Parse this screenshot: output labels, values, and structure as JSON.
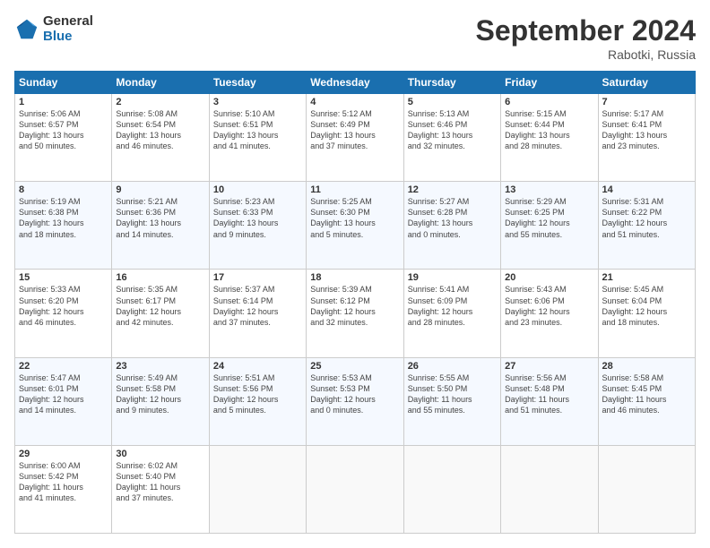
{
  "header": {
    "logo_general": "General",
    "logo_blue": "Blue",
    "month_title": "September 2024",
    "subtitle": "Rabotki, Russia"
  },
  "days_of_week": [
    "Sunday",
    "Monday",
    "Tuesday",
    "Wednesday",
    "Thursday",
    "Friday",
    "Saturday"
  ],
  "weeks": [
    [
      {
        "day": 1,
        "info": "Sunrise: 5:06 AM\nSunset: 6:57 PM\nDaylight: 13 hours\nand 50 minutes."
      },
      {
        "day": 2,
        "info": "Sunrise: 5:08 AM\nSunset: 6:54 PM\nDaylight: 13 hours\nand 46 minutes."
      },
      {
        "day": 3,
        "info": "Sunrise: 5:10 AM\nSunset: 6:51 PM\nDaylight: 13 hours\nand 41 minutes."
      },
      {
        "day": 4,
        "info": "Sunrise: 5:12 AM\nSunset: 6:49 PM\nDaylight: 13 hours\nand 37 minutes."
      },
      {
        "day": 5,
        "info": "Sunrise: 5:13 AM\nSunset: 6:46 PM\nDaylight: 13 hours\nand 32 minutes."
      },
      {
        "day": 6,
        "info": "Sunrise: 5:15 AM\nSunset: 6:44 PM\nDaylight: 13 hours\nand 28 minutes."
      },
      {
        "day": 7,
        "info": "Sunrise: 5:17 AM\nSunset: 6:41 PM\nDaylight: 13 hours\nand 23 minutes."
      }
    ],
    [
      {
        "day": 8,
        "info": "Sunrise: 5:19 AM\nSunset: 6:38 PM\nDaylight: 13 hours\nand 18 minutes."
      },
      {
        "day": 9,
        "info": "Sunrise: 5:21 AM\nSunset: 6:36 PM\nDaylight: 13 hours\nand 14 minutes."
      },
      {
        "day": 10,
        "info": "Sunrise: 5:23 AM\nSunset: 6:33 PM\nDaylight: 13 hours\nand 9 minutes."
      },
      {
        "day": 11,
        "info": "Sunrise: 5:25 AM\nSunset: 6:30 PM\nDaylight: 13 hours\nand 5 minutes."
      },
      {
        "day": 12,
        "info": "Sunrise: 5:27 AM\nSunset: 6:28 PM\nDaylight: 13 hours\nand 0 minutes."
      },
      {
        "day": 13,
        "info": "Sunrise: 5:29 AM\nSunset: 6:25 PM\nDaylight: 12 hours\nand 55 minutes."
      },
      {
        "day": 14,
        "info": "Sunrise: 5:31 AM\nSunset: 6:22 PM\nDaylight: 12 hours\nand 51 minutes."
      }
    ],
    [
      {
        "day": 15,
        "info": "Sunrise: 5:33 AM\nSunset: 6:20 PM\nDaylight: 12 hours\nand 46 minutes."
      },
      {
        "day": 16,
        "info": "Sunrise: 5:35 AM\nSunset: 6:17 PM\nDaylight: 12 hours\nand 42 minutes."
      },
      {
        "day": 17,
        "info": "Sunrise: 5:37 AM\nSunset: 6:14 PM\nDaylight: 12 hours\nand 37 minutes."
      },
      {
        "day": 18,
        "info": "Sunrise: 5:39 AM\nSunset: 6:12 PM\nDaylight: 12 hours\nand 32 minutes."
      },
      {
        "day": 19,
        "info": "Sunrise: 5:41 AM\nSunset: 6:09 PM\nDaylight: 12 hours\nand 28 minutes."
      },
      {
        "day": 20,
        "info": "Sunrise: 5:43 AM\nSunset: 6:06 PM\nDaylight: 12 hours\nand 23 minutes."
      },
      {
        "day": 21,
        "info": "Sunrise: 5:45 AM\nSunset: 6:04 PM\nDaylight: 12 hours\nand 18 minutes."
      }
    ],
    [
      {
        "day": 22,
        "info": "Sunrise: 5:47 AM\nSunset: 6:01 PM\nDaylight: 12 hours\nand 14 minutes."
      },
      {
        "day": 23,
        "info": "Sunrise: 5:49 AM\nSunset: 5:58 PM\nDaylight: 12 hours\nand 9 minutes."
      },
      {
        "day": 24,
        "info": "Sunrise: 5:51 AM\nSunset: 5:56 PM\nDaylight: 12 hours\nand 5 minutes."
      },
      {
        "day": 25,
        "info": "Sunrise: 5:53 AM\nSunset: 5:53 PM\nDaylight: 12 hours\nand 0 minutes."
      },
      {
        "day": 26,
        "info": "Sunrise: 5:55 AM\nSunset: 5:50 PM\nDaylight: 11 hours\nand 55 minutes."
      },
      {
        "day": 27,
        "info": "Sunrise: 5:56 AM\nSunset: 5:48 PM\nDaylight: 11 hours\nand 51 minutes."
      },
      {
        "day": 28,
        "info": "Sunrise: 5:58 AM\nSunset: 5:45 PM\nDaylight: 11 hours\nand 46 minutes."
      }
    ],
    [
      {
        "day": 29,
        "info": "Sunrise: 6:00 AM\nSunset: 5:42 PM\nDaylight: 11 hours\nand 41 minutes."
      },
      {
        "day": 30,
        "info": "Sunrise: 6:02 AM\nSunset: 5:40 PM\nDaylight: 11 hours\nand 37 minutes."
      },
      null,
      null,
      null,
      null,
      null
    ]
  ]
}
